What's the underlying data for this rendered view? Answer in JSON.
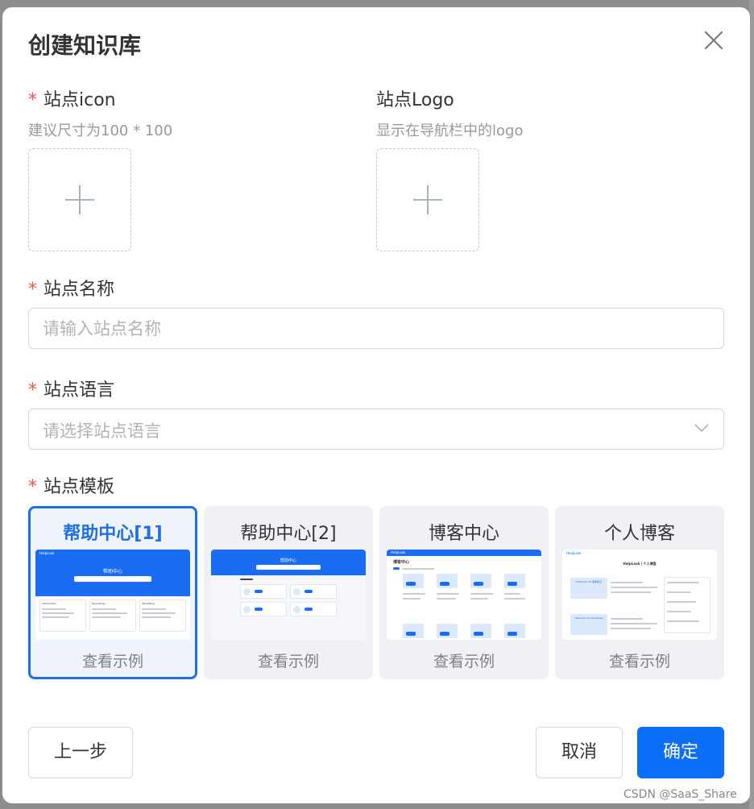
{
  "dialog": {
    "title": "创建知识库"
  },
  "fields": {
    "icon": {
      "required_mark": "*",
      "label": "站点icon",
      "hint": "建议尺寸为100 * 100"
    },
    "logo": {
      "label": "站点Logo",
      "hint": "显示在导航栏中的logo"
    },
    "name": {
      "required_mark": "*",
      "label": "站点名称",
      "placeholder": "请输入站点名称",
      "value": ""
    },
    "language": {
      "required_mark": "*",
      "label": "站点语言",
      "placeholder": "请选择站点语言"
    },
    "template": {
      "required_mark": "*",
      "label": "站点模板"
    }
  },
  "templates": [
    {
      "name": "帮助中心[1]",
      "link": "查看示例",
      "selected": true,
      "thumb": {
        "brand": "HelpLook",
        "hero": "帮助中心",
        "cards": [
          "Introduction",
          "Recordings",
          "VR-Setting"
        ]
      }
    },
    {
      "name": "帮助中心[2]",
      "link": "查看示例",
      "selected": false,
      "thumb": {
        "hero": "帮助中心"
      }
    },
    {
      "name": "博客中心",
      "link": "查看示例",
      "selected": false,
      "thumb": {
        "brand": "HelpLook",
        "heading": "博客中心"
      }
    },
    {
      "name": "个人博客",
      "link": "查看示例",
      "selected": false,
      "thumb": {
        "brand": "HelpLook",
        "heading": "HelpLook | 个人博客",
        "badge1": "HelpLook VS 语雀笔记",
        "badge2": "HelpLook VS WordPress"
      }
    }
  ],
  "buttons": {
    "prev": "上一步",
    "cancel": "取消",
    "confirm": "确定"
  },
  "watermark": "CSDN @SaaS_Share",
  "colors": {
    "accent": "#0c6ef6",
    "required": "#f5574b",
    "selected_border": "#1f6fe5"
  }
}
